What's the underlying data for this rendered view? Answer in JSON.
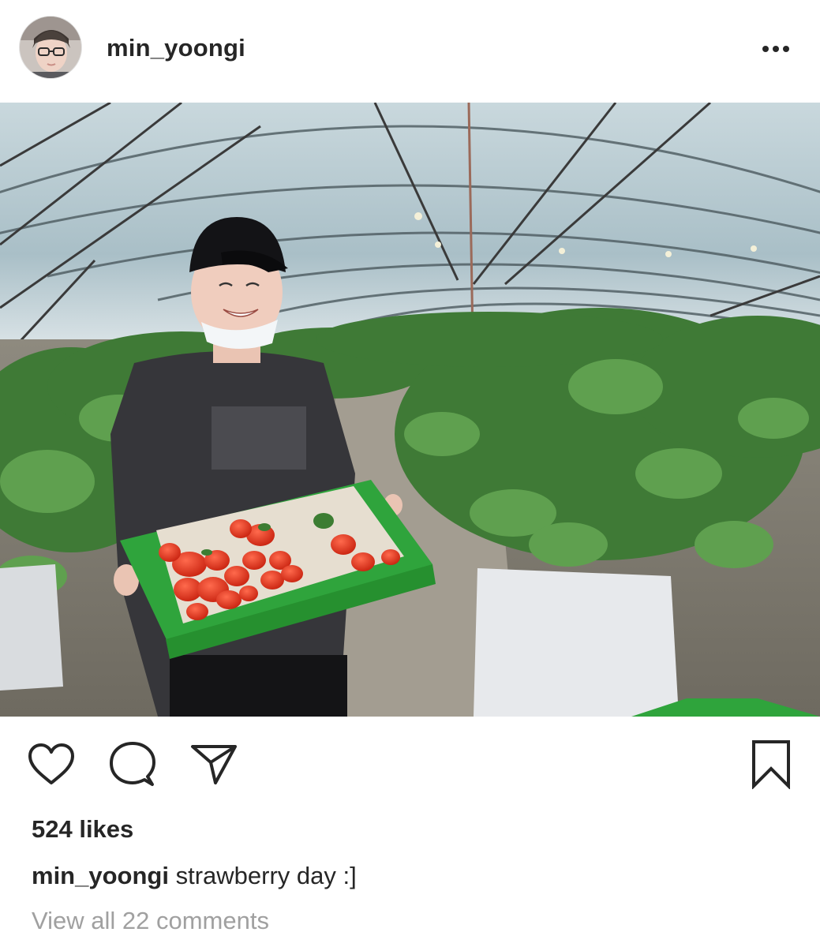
{
  "post": {
    "username": "min_yoongi",
    "more_icon": "more-horizontal-icon",
    "likes_text": "524 likes",
    "caption_user": "min_yoongi",
    "caption_text": "strawberry day :]",
    "view_comments": "View all 22 comments"
  },
  "actions": {
    "like_icon": "heart-icon",
    "comment_icon": "comment-bubble-icon",
    "share_icon": "paper-plane-icon",
    "save_icon": "bookmark-icon"
  },
  "colors": {
    "text": "#262626",
    "muted": "#a0a0a0",
    "background": "#ffffff"
  }
}
